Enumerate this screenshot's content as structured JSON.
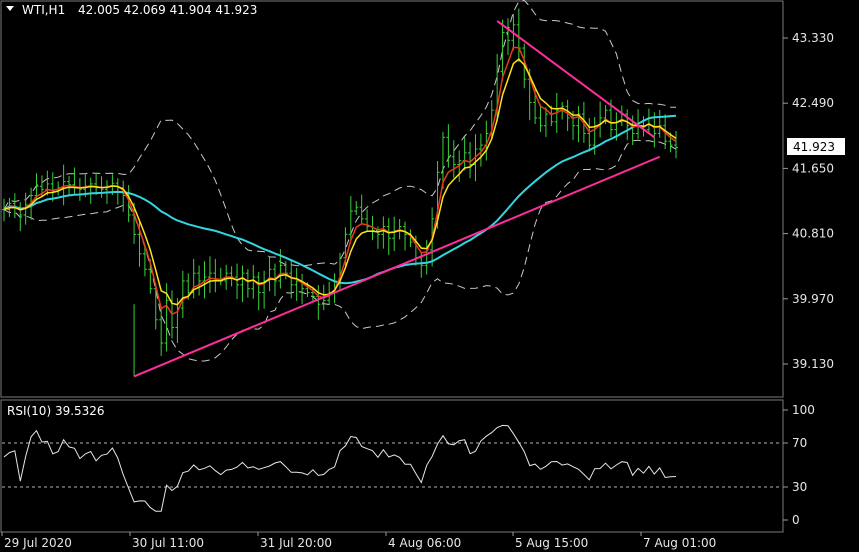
{
  "header": {
    "symbol": "WTI,H1",
    "ohlc": "42.005 42.069 41.904 41.923",
    "indicator": "RSI(10) 39.5326"
  },
  "chart_data": {
    "type": "candlestick",
    "price_axis": {
      "ticks": [
        "43.330",
        "42.490",
        "41.650",
        "40.810",
        "39.970",
        "39.130"
      ],
      "range": [
        38.83,
        43.62
      ]
    },
    "current_price": "41.923",
    "x_ticks": [
      "29 Jul 2020",
      "30 Jul 11:00",
      "31 Jul 20:00",
      "4 Aug 06:00",
      "5 Aug 15:00",
      "7 Aug 01:00"
    ],
    "rsi_axis": {
      "ticks": [
        "100",
        "70",
        "30",
        "0"
      ],
      "levels": [
        70,
        30
      ],
      "value": 39.5326
    },
    "close_series": [
      41.12,
      41.2,
      41.15,
      41.05,
      41.18,
      41.3,
      41.42,
      41.38,
      41.45,
      41.36,
      41.4,
      41.48,
      41.44,
      41.4,
      41.38,
      41.42,
      41.45,
      41.4,
      41.38,
      41.42,
      41.46,
      41.4,
      41.3,
      41.05,
      40.8,
      40.55,
      40.35,
      40.1,
      39.7,
      39.4,
      39.95,
      39.6,
      39.85,
      40.2,
      40.05,
      40.3,
      40.2,
      40.25,
      40.3,
      40.22,
      40.2,
      40.3,
      40.25,
      40.15,
      40.3,
      40.1,
      40.25,
      40.05,
      40.2,
      40.35,
      40.2,
      40.4,
      40.3,
      40.15,
      40.2,
      40.1,
      40.05,
      40.0,
      39.9,
      39.95,
      40.05,
      40.2,
      40.5,
      40.8,
      41.1,
      41.15,
      41.0,
      40.9,
      40.85,
      40.8,
      40.9,
      40.75,
      40.85,
      40.9,
      40.8,
      40.7,
      40.5,
      40.4,
      40.6,
      41.0,
      41.6,
      42.05,
      41.8,
      41.7,
      41.75,
      41.85,
      41.7,
      41.9,
      41.95,
      42.1,
      42.4,
      42.9,
      43.4,
      43.3,
      43.5,
      43.2,
      42.8,
      42.5,
      42.3,
      42.2,
      42.35,
      42.25,
      42.4,
      42.45,
      42.3,
      42.2,
      42.35,
      42.1,
      41.95,
      42.2,
      42.3,
      42.4,
      42.15,
      42.25,
      42.35,
      42.2,
      42.1,
      42.2,
      42.15,
      42.3,
      42.1,
      42.2,
      42.0,
      41.95,
      41.92
    ],
    "trend_lines": [
      {
        "name": "upper-resistance",
        "from": [
          91,
          43.55
        ],
        "to": [
          120,
          42.05
        ]
      },
      {
        "name": "lower-support",
        "from": [
          24,
          38.97
        ],
        "to": [
          121,
          41.8
        ]
      }
    ],
    "colors": {
      "candle": "#3bd13b",
      "ema_fast": "#e83a1f",
      "ema_slow": "#ffe21a",
      "ma_long": "#33d6e0",
      "bands": "#c8c8c8",
      "trend": "#ff2d9c",
      "rsi": "#e6e6e6",
      "grid": "#ffffff",
      "text": "#e6e6e6"
    }
  }
}
